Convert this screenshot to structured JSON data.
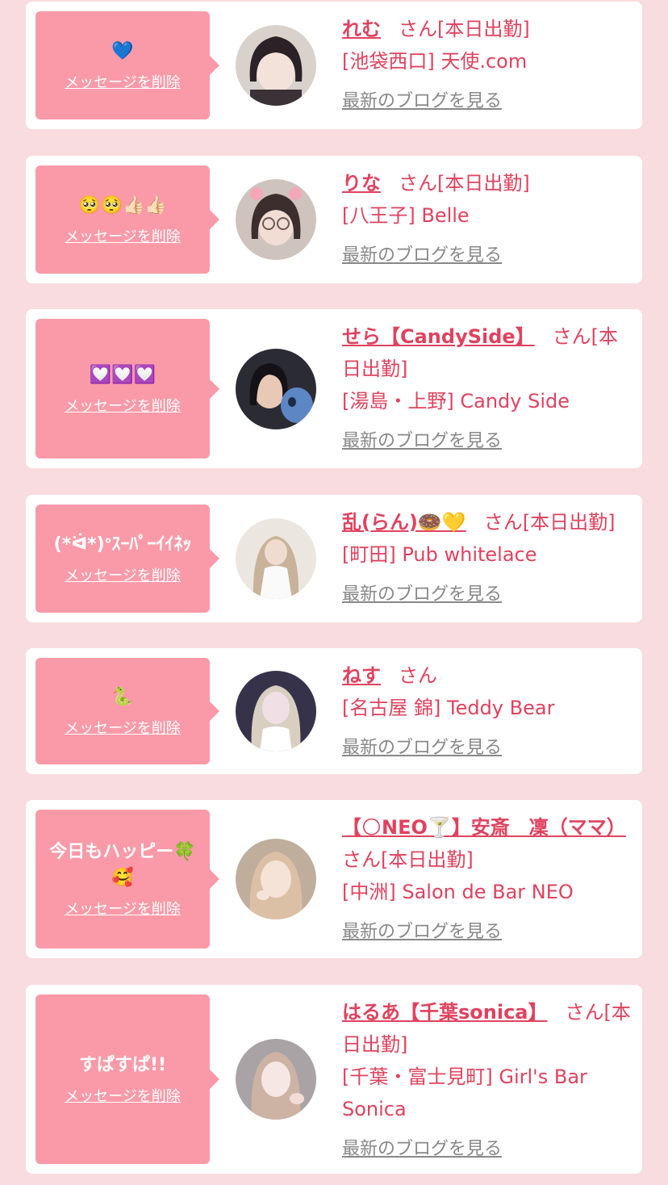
{
  "delete_label": "メッセージを削除",
  "blog_label": "最新のブログを見る",
  "items": [
    {
      "message": "💙",
      "name": "れむ",
      "suffix": "さん[本日出勤]",
      "shop": "[池袋西口] 天使.com"
    },
    {
      "message": "🥺🥺👍🏻👍🏻",
      "name": "りな",
      "suffix": "さん[本日出勤]",
      "shop": "[八王子] Belle"
    },
    {
      "message": "💟💟💟",
      "name": "せら【CandySide】",
      "suffix": "さん[本日出勤]",
      "shop": "[湯島・上野] Candy Side"
    },
    {
      "message": "(*ᐛ*)ᐤｽｰﾊﾟｰｲｲﾈｯ",
      "name": "乱(らん)🍩💛",
      "suffix": "さん[本日出勤]",
      "shop": "[町田] Pub whitelace"
    },
    {
      "message": "🐍",
      "name": "ねす",
      "suffix": "さん",
      "shop": "[名古屋 錦] Teddy Bear"
    },
    {
      "message": "今日もハッピー🍀🥰",
      "name": "【🌕NEO🍸】安斎　凜（ママ）",
      "suffix": "さん[本日出勤]",
      "shop": "[中洲] Salon de Bar NEO"
    },
    {
      "message": "すぱすぱ!!",
      "name": "はるあ【千葉sonica】",
      "suffix": "さん[本日出勤]",
      "shop": "[千葉・富士見町] Girl's Bar Sonica"
    }
  ],
  "colors": {
    "accent": "#e0425e",
    "bubble": "#fa9aa8",
    "background": "#f8dce0",
    "link_gray": "#888888"
  }
}
